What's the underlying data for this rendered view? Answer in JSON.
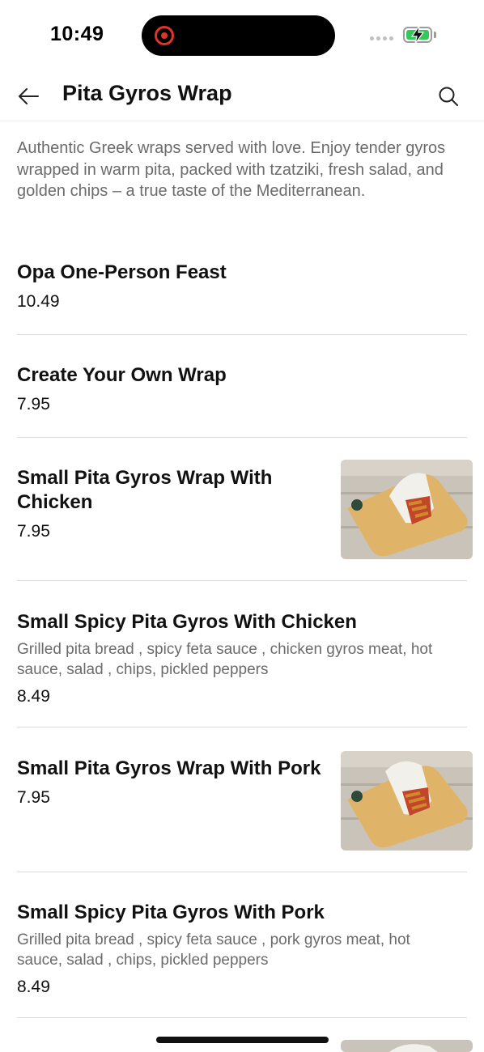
{
  "status": {
    "time": "10:49"
  },
  "header": {
    "title": "Pita Gyros Wrap",
    "back_icon": "arrow-left-icon",
    "search_icon": "search-icon"
  },
  "category": {
    "description": "Authentic Greek wraps served with love. Enjoy tender gyros wrapped in warm pita, packed with tzatziki, fresh salad, and golden chips – a true taste of the Mediterranean."
  },
  "items": [
    {
      "name": "Opa One-Person Feast",
      "price": "10.49"
    },
    {
      "name": "Create Your Own Wrap",
      "price": "7.95"
    },
    {
      "name": "Small Pita Gyros Wrap With Chicken",
      "price": "7.95"
    },
    {
      "name": "Small Spicy Pita Gyros With Chicken",
      "description": "Grilled pita bread , spicy feta sauce , chicken gyros meat, hot sauce, salad , chips, pickled peppers",
      "price": "8.49"
    },
    {
      "name": "Small Pita Gyros Wrap With Pork",
      "price": "7.95"
    },
    {
      "name": "Small Spicy Pita Gyros With Pork",
      "description": "Grilled pita bread , spicy feta sauce , pork  gyros meat, hot sauce, salad , chips, pickled peppers",
      "price": "8.49"
    }
  ],
  "colors": {
    "battery": "#34c759",
    "record": "#e0342b"
  }
}
